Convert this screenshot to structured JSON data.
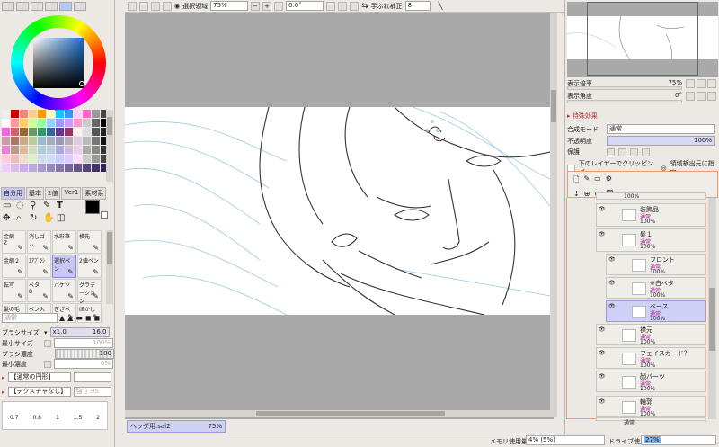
{
  "toolbar": {
    "selection_label": "選択領域",
    "zoom": "75%",
    "rotation": "0.0°",
    "stabilizer_label": "手ぶれ補正",
    "stabilizer": "8"
  },
  "navigator": {
    "zoom_label": "表示倍率",
    "zoom_value": "75%",
    "angle_label": "表示角度",
    "angle_value": "0°"
  },
  "effects_header": "特殊効果",
  "layer_props": {
    "blend_label": "合成モード",
    "blend_value": "通常",
    "opacity_label": "不透明度",
    "opacity_value": "100%",
    "protect_label": "保護",
    "clip_label": "下のレイヤーでクリッピング",
    "detect_label": "領域検出元に指定"
  },
  "layers": [
    {
      "name": "",
      "mode": "",
      "opacity": "100%"
    },
    {
      "name": "装飾品",
      "mode": "通常",
      "opacity": "100%"
    },
    {
      "name": "髪１",
      "mode": "通常",
      "opacity": "100%"
    },
    {
      "name": "フロント",
      "mode": "通常",
      "opacity": "100%"
    },
    {
      "name": "※白ベタ",
      "mode": "通常",
      "opacity": "100%"
    },
    {
      "name": "ベース",
      "mode": "通常",
      "opacity": "100%"
    },
    {
      "name": "襟元",
      "mode": "通常",
      "opacity": "100%"
    },
    {
      "name": "フェイスガード？",
      "mode": "通常",
      "opacity": "100%"
    },
    {
      "name": "顔パーツ",
      "mode": "通常",
      "opacity": "100%"
    },
    {
      "name": "輪郭",
      "mode": "通常",
      "opacity": "100%"
    },
    {
      "name": "",
      "mode": "通常",
      "opacity": ""
    }
  ],
  "tool_tabs": [
    "自分用",
    "基本",
    "2値",
    "Ver1",
    "素材系"
  ],
  "brushes": [
    {
      "label": "金網",
      "key": "Z"
    },
    {
      "label": "消しゴム",
      "key": ""
    },
    {
      "label": "水彩筆",
      "key": ""
    },
    {
      "label": "横先",
      "key": ""
    },
    {
      "label": "金網２",
      "key": ""
    },
    {
      "label": "ｴｱﾌﾞﾗｼ",
      "key": ""
    },
    {
      "label": "選択ペン",
      "key": ""
    },
    {
      "label": "2値ペン",
      "key": ""
    },
    {
      "label": "転写",
      "key": ""
    },
    {
      "label": "ベタ",
      "key": "B"
    },
    {
      "label": "バケツ",
      "key": ""
    },
    {
      "label": "グラデーション",
      "key": ""
    },
    {
      "label": "髪の毛",
      "key": ""
    },
    {
      "label": "ペン入れ",
      "key": ""
    },
    {
      "label": "ぎざペン",
      "key": ""
    },
    {
      "label": "ぼかし",
      "key": ""
    }
  ],
  "brush_settings": {
    "mode": "通常",
    "size_label": "ブラシサイズ",
    "size_mult": "x1.0",
    "size_value": "16.0",
    "min_size_label": "最小サイズ",
    "min_size_value": "100%",
    "density_label": "ブラシ濃度",
    "density_value": "100",
    "min_density_label": "最小濃度",
    "min_density_value": "0%",
    "shape": "【通常の円形】",
    "texture": "【テクスチャなし】",
    "texture_strength": "強さ 95",
    "sizes": [
      "0.7",
      "0.8",
      "1",
      "1.5",
      "2"
    ]
  },
  "document_tab": {
    "name": "ヘッダ用.sai2",
    "zoom": "75%"
  },
  "status": {
    "memory_label": "メモリ使用量",
    "memory_value": "4% (5%)",
    "drive_label": "ドライブ使用量",
    "drive_value": "27%"
  },
  "colors": {
    "current": "#000000",
    "selection": "#c7c7f2",
    "layer_sel": "#cfd0f5"
  }
}
